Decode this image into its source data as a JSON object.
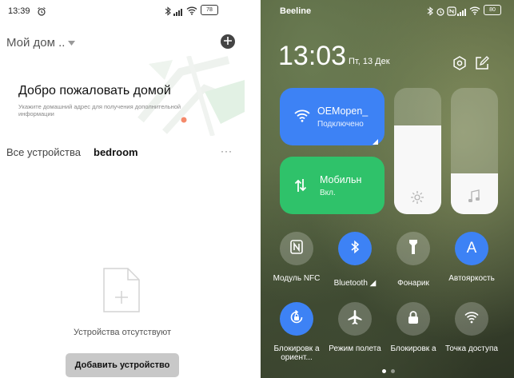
{
  "left": {
    "status": {
      "time": "13:39",
      "battery": "78"
    },
    "home_selector": "Мой дом ..",
    "welcome_title": "Добро пожаловать домой",
    "welcome_subtitle": "Укажите домашний адрес для получения дополнительной информации",
    "tabs": {
      "all": "Все устройства",
      "bedroom": "bedroom",
      "more": "···"
    },
    "empty_text": "Устройства отсутствуют",
    "add_button": "Добавить устройство"
  },
  "right": {
    "carrier": "Beeline",
    "battery": "80",
    "time": "13:03",
    "date": "Пт, 13 Дек",
    "wifi_tile": {
      "name": "OEMopen_",
      "status": "Подключено"
    },
    "mobile_tile": {
      "name": "Мобильн",
      "status": "Вкл."
    },
    "brightness_level": 0.7,
    "volume_level": 0.32,
    "toggles": [
      {
        "label": "Модуль NFC"
      },
      {
        "label": "Bluetooth ◢"
      },
      {
        "label": "Фонарик"
      },
      {
        "label": "Автояркость"
      },
      {
        "label": "Блокировк а ориент..."
      },
      {
        "label": "Режим полета"
      },
      {
        "label": "Блокировк а"
      },
      {
        "label": "Точка доступа"
      }
    ],
    "colors": {
      "accent_blue": "#3d82f5",
      "accent_green": "#2fc26a"
    }
  }
}
